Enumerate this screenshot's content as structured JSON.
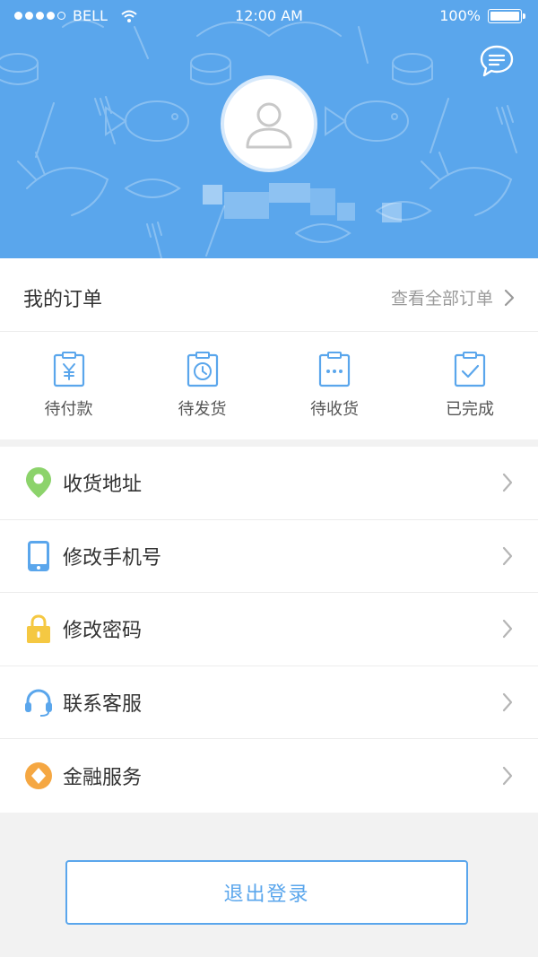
{
  "status_bar": {
    "carrier": "BELL",
    "time": "12:00 AM",
    "battery": "100%"
  },
  "colors": {
    "primary": "#5aa6ec",
    "location_green": "#8cd36b",
    "lock_yellow": "#f5c842",
    "finance_orange": "#f5a742"
  },
  "profile": {
    "avatar_icon": "user-silhouette-icon",
    "message_icon": "chat-bubble-icon"
  },
  "orders": {
    "title": "我的订单",
    "view_all": "查看全部订单",
    "items": [
      {
        "label": "待付款",
        "icon": "payment-icon"
      },
      {
        "label": "待发货",
        "icon": "clock-icon"
      },
      {
        "label": "待收货",
        "icon": "receiving-icon"
      },
      {
        "label": "已完成",
        "icon": "check-icon"
      }
    ]
  },
  "menu": [
    {
      "label": "收货地址",
      "icon": "location-pin-icon"
    },
    {
      "label": "修改手机号",
      "icon": "phone-icon"
    },
    {
      "label": "修改密码",
      "icon": "lock-icon"
    },
    {
      "label": "联系客服",
      "icon": "headset-icon"
    },
    {
      "label": "金融服务",
      "icon": "finance-icon"
    }
  ],
  "logout_label": "退出登录"
}
